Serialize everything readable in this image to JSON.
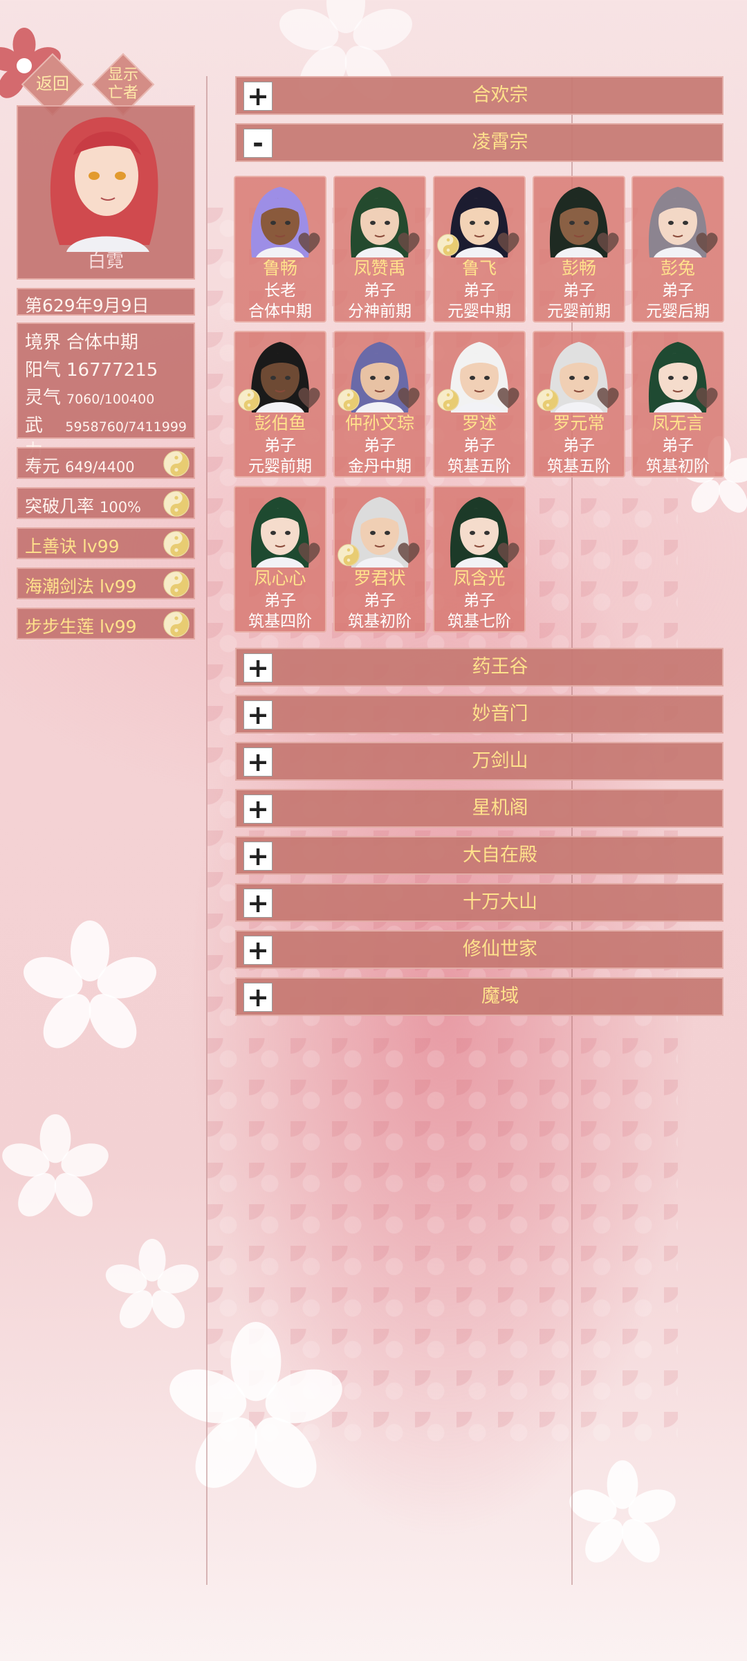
{
  "top_buttons": {
    "back": "返回",
    "show_dead_1": "显示",
    "show_dead_2": "亡者"
  },
  "player": {
    "name": "白霓",
    "date": "第629年9月9日",
    "stats": [
      {
        "key": "境界",
        "value": "合体中期",
        "small": false
      },
      {
        "key": "阳气",
        "value": "16777215",
        "small": false
      },
      {
        "key": "灵气",
        "value": "7060/100400",
        "small": true
      },
      {
        "key": "武力",
        "value": "5958760/7411999",
        "small": true
      }
    ],
    "extras": [
      {
        "label": "寿元",
        "value": "649/4400",
        "gold": false
      },
      {
        "label": "突破几率",
        "value": "100%",
        "gold": false
      },
      {
        "label": "上善诀",
        "value": "lv99",
        "gold": true
      },
      {
        "label": "海潮剑法",
        "value": "lv99",
        "gold": true
      },
      {
        "label": "步步生莲",
        "value": "lv99",
        "gold": true
      }
    ]
  },
  "sects": [
    {
      "name": "合欢宗",
      "toggle": "+"
    },
    {
      "name": "凌霄宗",
      "toggle": "-"
    },
    {
      "name": "药王谷",
      "toggle": "+"
    },
    {
      "name": "妙音门",
      "toggle": "+"
    },
    {
      "name": "万剑山",
      "toggle": "+"
    },
    {
      "name": "星机阁",
      "toggle": "+"
    },
    {
      "name": "大自在殿",
      "toggle": "+"
    },
    {
      "name": "十万大山",
      "toggle": "+"
    },
    {
      "name": "修仙世家",
      "toggle": "+"
    },
    {
      "name": "魔域",
      "toggle": "+"
    }
  ],
  "members": [
    {
      "name": "鲁畅",
      "role": "长老",
      "realm": "合体中期",
      "hair": "#9d8ee6",
      "skin": "#8a5a3c",
      "yinyang": false
    },
    {
      "name": "凤赞禹",
      "role": "弟子",
      "realm": "分神前期",
      "hair": "#244a2e",
      "skin": "#f0d0b8",
      "yinyang": false
    },
    {
      "name": "鲁飞",
      "role": "弟子",
      "realm": "元婴中期",
      "hair": "#1c1c30",
      "skin": "#f3d3b6",
      "yinyang": true
    },
    {
      "name": "彭畅",
      "role": "弟子",
      "realm": "元婴前期",
      "hair": "#1e2a22",
      "skin": "#8a6044",
      "yinyang": false
    },
    {
      "name": "彭兔",
      "role": "弟子",
      "realm": "元婴后期",
      "hair": "#8c8490",
      "skin": "#f3d8c6",
      "yinyang": false
    },
    {
      "name": "彭伯鱼",
      "role": "弟子",
      "realm": "元婴前期",
      "hair": "#1a1a1a",
      "skin": "#6e4a34",
      "yinyang": true
    },
    {
      "name": "仲孙文琮",
      "role": "弟子",
      "realm": "金丹中期",
      "hair": "#6a6aa8",
      "skin": "#e8c2a4",
      "yinyang": true
    },
    {
      "name": "罗述",
      "role": "弟子",
      "realm": "筑基五阶",
      "hair": "#f2f2f2",
      "skin": "#f1d0b6",
      "yinyang": true
    },
    {
      "name": "罗元常",
      "role": "弟子",
      "realm": "筑基五阶",
      "hair": "#e0e0e0",
      "skin": "#f0cfb4",
      "yinyang": true
    },
    {
      "name": "凤无言",
      "role": "弟子",
      "realm": "筑基初阶",
      "hair": "#1f4a32",
      "skin": "#f5dccc",
      "yinyang": false
    },
    {
      "name": "凤心心",
      "role": "弟子",
      "realm": "筑基四阶",
      "hair": "#1e4a30",
      "skin": "#f5dccc",
      "yinyang": false
    },
    {
      "name": "罗君状",
      "role": "弟子",
      "realm": "筑基初阶",
      "hair": "#dcdcdc",
      "skin": "#f0cfb4",
      "yinyang": true
    },
    {
      "name": "凤含光",
      "role": "弟子",
      "realm": "筑基七阶",
      "hair": "#1c3a28",
      "skin": "#f5dccc",
      "yinyang": false
    }
  ]
}
